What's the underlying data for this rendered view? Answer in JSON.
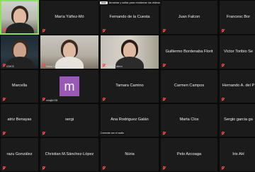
{
  "banner": {
    "badge": "Hide",
    "text": "Arrastrar y soltar para reordenar los videos"
  },
  "tag_overlay": "Conectar con el audio",
  "tiles": [
    {
      "name": "",
      "caption": "",
      "video": "v1",
      "active": true
    },
    {
      "name": "María Yáñez-Mó",
      "caption": "",
      "video": "",
      "active": false
    },
    {
      "name": "Fernando de la Cuesta",
      "caption": "",
      "video": "",
      "active": false
    },
    {
      "name": "Juan Falcon",
      "caption": "",
      "video": "",
      "active": false
    },
    {
      "name": "Francesc Bor",
      "caption": "",
      "video": "",
      "active": false
    },
    {
      "name": "",
      "caption": "ICMCE",
      "video": "v2",
      "active": false
    },
    {
      "name": "",
      "caption": "María Castellano Ibarra",
      "video": "v3",
      "active": false
    },
    {
      "name": "",
      "caption": "María L. Valero",
      "video": "v4",
      "active": false
    },
    {
      "name": "Guillermo Bordenaba Florit",
      "caption": "",
      "video": "",
      "active": false
    },
    {
      "name": "Víctor Toribio Se",
      "caption": "",
      "video": "",
      "active": false
    },
    {
      "name": "Marcella",
      "caption": "",
      "video": "",
      "active": false
    },
    {
      "name": "",
      "caption": "mhajibi EB",
      "video": "avatar",
      "active": false
    },
    {
      "name": "Tamara Camino",
      "caption": "",
      "video": "",
      "active": false
    },
    {
      "name": "Carmen Campos",
      "caption": "",
      "video": "",
      "active": false
    },
    {
      "name": "Hernando A. del P",
      "caption": "",
      "video": "",
      "active": false
    },
    {
      "name": "atriz Benayas",
      "caption": "",
      "video": "",
      "active": false
    },
    {
      "name": "sergi",
      "caption": "",
      "video": "",
      "active": false
    },
    {
      "name": "Ana Rodriguez Galán",
      "caption": "",
      "video": "",
      "active": false
    },
    {
      "name": "Marta Clos",
      "caption": "",
      "video": "",
      "active": false
    },
    {
      "name": "Sergio garcia ga",
      "caption": "",
      "video": "",
      "active": false
    },
    {
      "name": "razu González",
      "caption": "",
      "video": "",
      "active": false
    },
    {
      "name": "Christian M.Sánchez-López",
      "caption": "",
      "video": "",
      "active": false
    },
    {
      "name": "Núria",
      "caption": "",
      "video": "",
      "active": false
    },
    {
      "name": "Pelo Azcoaga",
      "caption": "",
      "video": "",
      "active": false
    },
    {
      "name": "Iris AH",
      "caption": "",
      "video": "",
      "active": false
    }
  ],
  "avatar_letter": "m",
  "colors": {
    "active_border": "#8fe05a",
    "mic_muted": "#ff4a4a",
    "avatar_bg": "#9b59b6"
  }
}
